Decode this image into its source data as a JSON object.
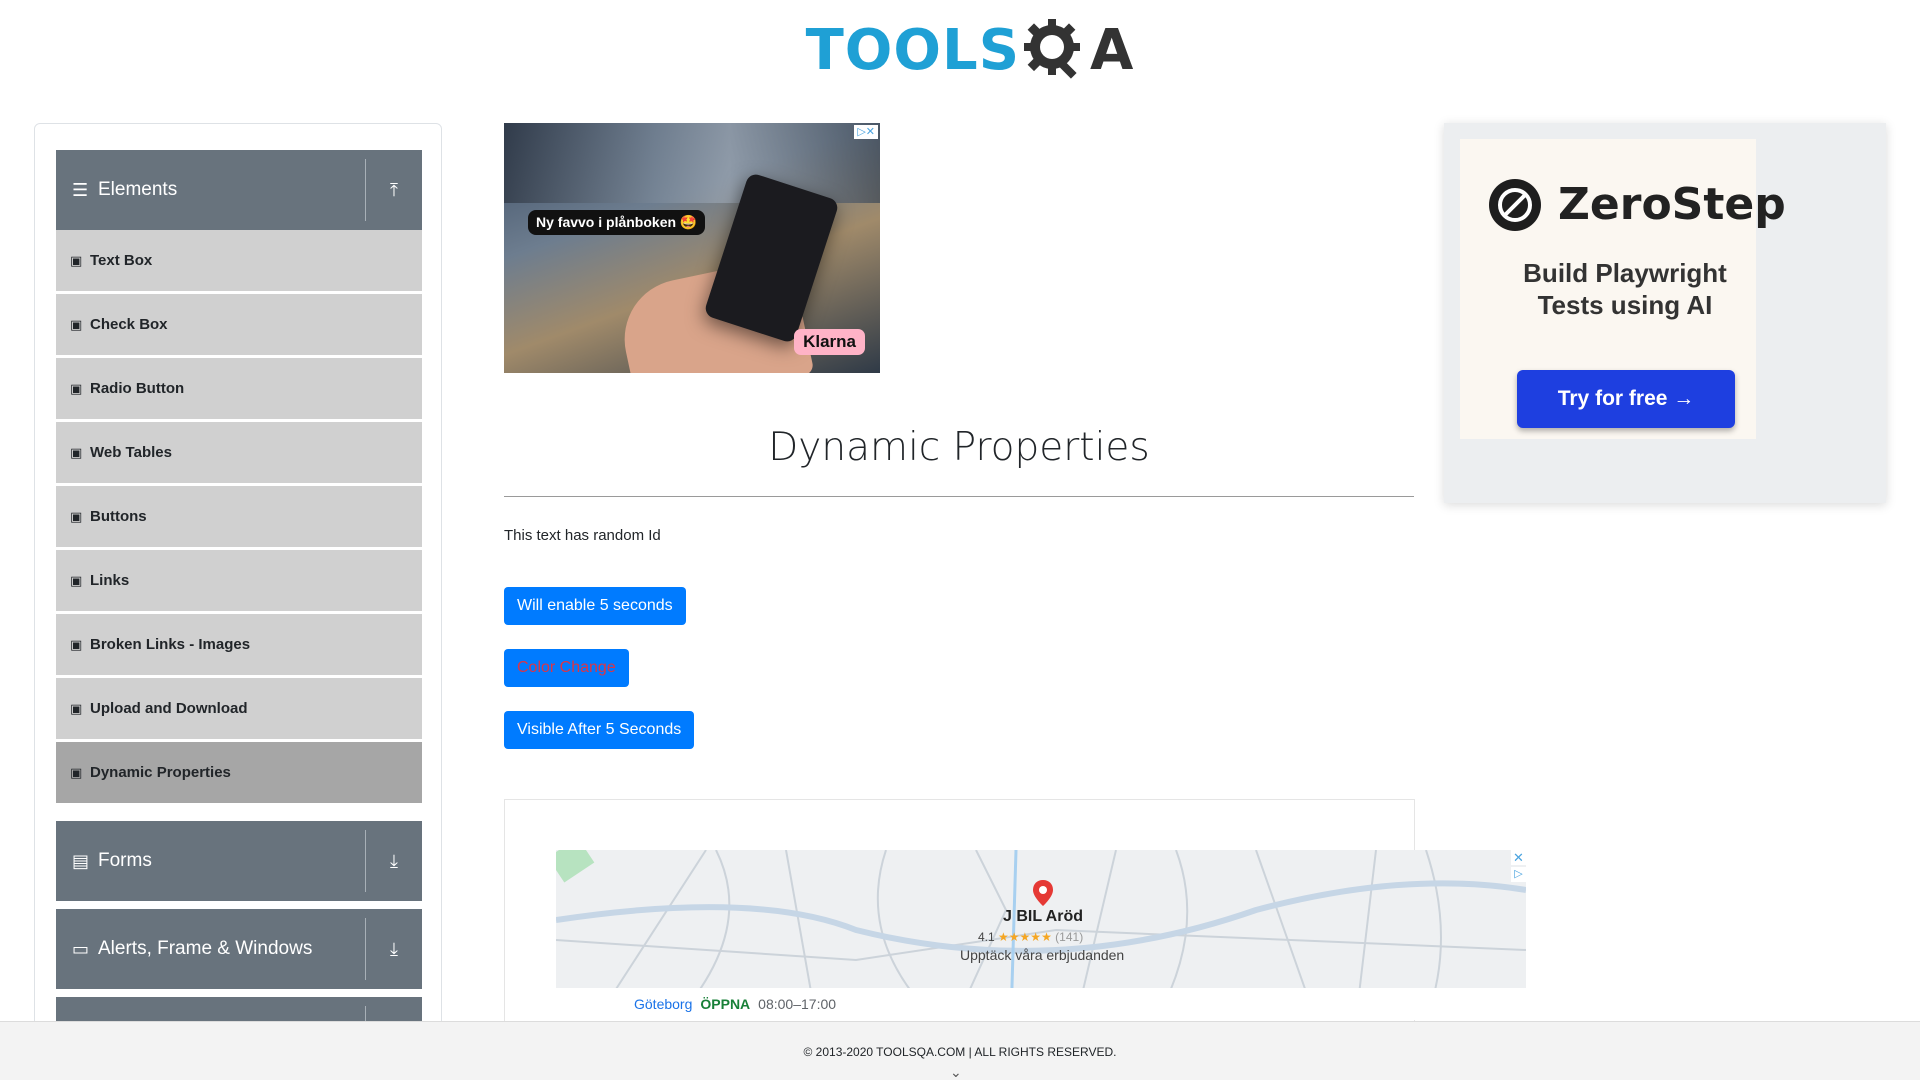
{
  "header": {
    "logo_part1": "TOOLS",
    "logo_part2": "A",
    "logo_icon": "gear-q-icon"
  },
  "sidebar": {
    "groups": [
      {
        "label": "Elements",
        "icon": "hamburger-icon",
        "arrow": "upload-arrow-icon"
      },
      {
        "label": "Forms",
        "icon": "document-icon",
        "arrow": "download-arrow-icon"
      },
      {
        "label": "Alerts, Frame & Windows",
        "icon": "window-icon",
        "arrow": "download-arrow-icon"
      }
    ],
    "items": [
      {
        "label": "Text Box",
        "active": false
      },
      {
        "label": "Check Box",
        "active": false
      },
      {
        "label": "Radio Button",
        "active": false
      },
      {
        "label": "Web Tables",
        "active": false
      },
      {
        "label": "Buttons",
        "active": false
      },
      {
        "label": "Links",
        "active": false
      },
      {
        "label": "Broken Links - Images",
        "active": false
      },
      {
        "label": "Upload and Download",
        "active": false
      },
      {
        "label": "Dynamic Properties",
        "active": true
      }
    ]
  },
  "ad_left": {
    "bubble": "Ny favvo i plånboken 🤩",
    "brand": "Klarna"
  },
  "main": {
    "title": "Dynamic Properties",
    "random_text": "This text has random Id",
    "buttons": {
      "enable": "Will enable 5 seconds",
      "color": "Color Change",
      "visible": "Visible After 5 Seconds"
    }
  },
  "map_ad": {
    "name": "J BIL Aröd",
    "rating": "4.1",
    "stars": "★★★★★",
    "count": "(141)",
    "offer": "Upptäck våra erbjudanden",
    "city": "Göteborg",
    "status": "ÖPPNA",
    "hours": "08:00–17:00",
    "close": "✕",
    "adchoice": "▷"
  },
  "ad_right": {
    "brand": "ZeroStep",
    "subtitle_line1": "Build Playwright",
    "subtitle_line2": "Tests using AI",
    "cta": "Try for free →"
  },
  "footer": {
    "copyright": "© 2013-2020 TOOLSQA.COM | ALL RIGHTS RESERVED."
  },
  "colors": {
    "primary": "#007bff",
    "sidebar_group": "#68737d",
    "sidebar_item": "#d0d0d0",
    "sidebar_active": "#a6a6a6",
    "logo_blue": "#1fa0d5"
  }
}
